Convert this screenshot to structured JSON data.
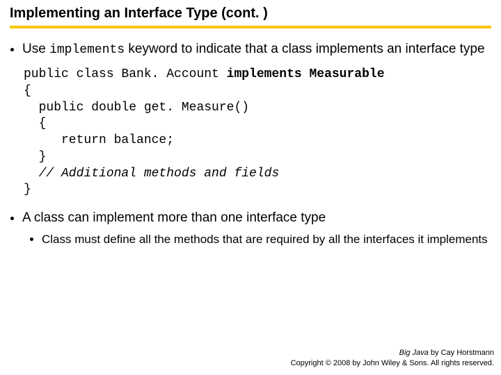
{
  "title": "Implementing an Interface Type  (cont. )",
  "bullet1_pre": "Use ",
  "bullet1_kw": "implements",
  "bullet1_post": " keyword to indicate that a class implements an interface type",
  "code": {
    "l1a": "public class Bank. Account ",
    "l1b": "implements Measurable",
    "l2": "{",
    "l3": "  public double get. Measure()",
    "l4": "  {",
    "l5": "     return balance;",
    "l6": "  }",
    "l7": "  // Additional methods and fields",
    "l8": "}"
  },
  "bullet2": "A class can implement more than one interface type",
  "sub1": "Class must define all the methods that are required by all the interfaces it implements",
  "footer": {
    "bookname": "Big Java",
    "byline": " by Cay Horstmann",
    "copyright": "Copyright © 2008 by John Wiley & Sons. All rights reserved."
  }
}
